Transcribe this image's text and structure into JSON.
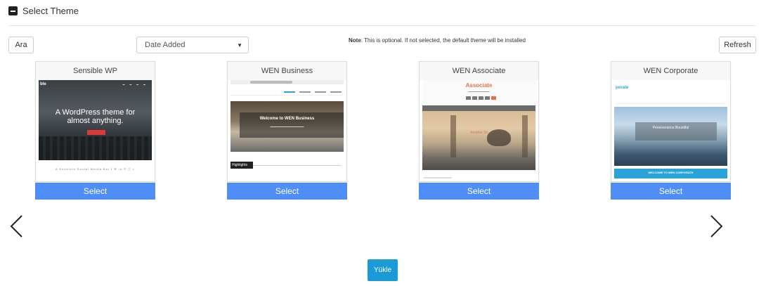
{
  "section": {
    "title": "Select Theme",
    "collapse_icon": "minus-square-icon"
  },
  "toolbar": {
    "search_label": "Ara",
    "sort_value": "Date Added",
    "note_label": "Note",
    "note_text": ": This is optional. If not selected, the default theme will be installed",
    "refresh_label": "Refresh"
  },
  "themes": [
    {
      "name": "Sensible WP",
      "select_label": "Select",
      "preview": {
        "logo": "ble",
        "headline_1": "A WordPress theme for",
        "headline_2": "almost anything.",
        "social": "A Sensible Social Media Bar  f  ✉  in  ⚲  ◻  ⌂"
      }
    },
    {
      "name": "WEN Business",
      "select_label": "Select",
      "preview": {
        "hero_title": "Welcome to WEN Business",
        "section_label": "Highlights"
      }
    },
    {
      "name": "WEN Associate",
      "select_label": "Select",
      "preview": {
        "site_title": "Associate",
        "hero_text": "Another Sli"
      }
    },
    {
      "name": "WEN Corporate",
      "select_label": "Select",
      "preview": {
        "logo": "porate",
        "hero_title": "Perseverance Bountiful",
        "band_title": "WELCOME TO WEN CORPORATE"
      }
    }
  ],
  "carousel": {
    "prev_icon": "chevron-left-icon",
    "next_icon": "chevron-right-icon"
  },
  "footer": {
    "install_label": "Yükle"
  },
  "colors": {
    "select_button": "#4f8ef7",
    "install_button": "#1a9ad6",
    "associate_accent": "#e8734a",
    "corporate_accent": "#2aa3d8"
  }
}
